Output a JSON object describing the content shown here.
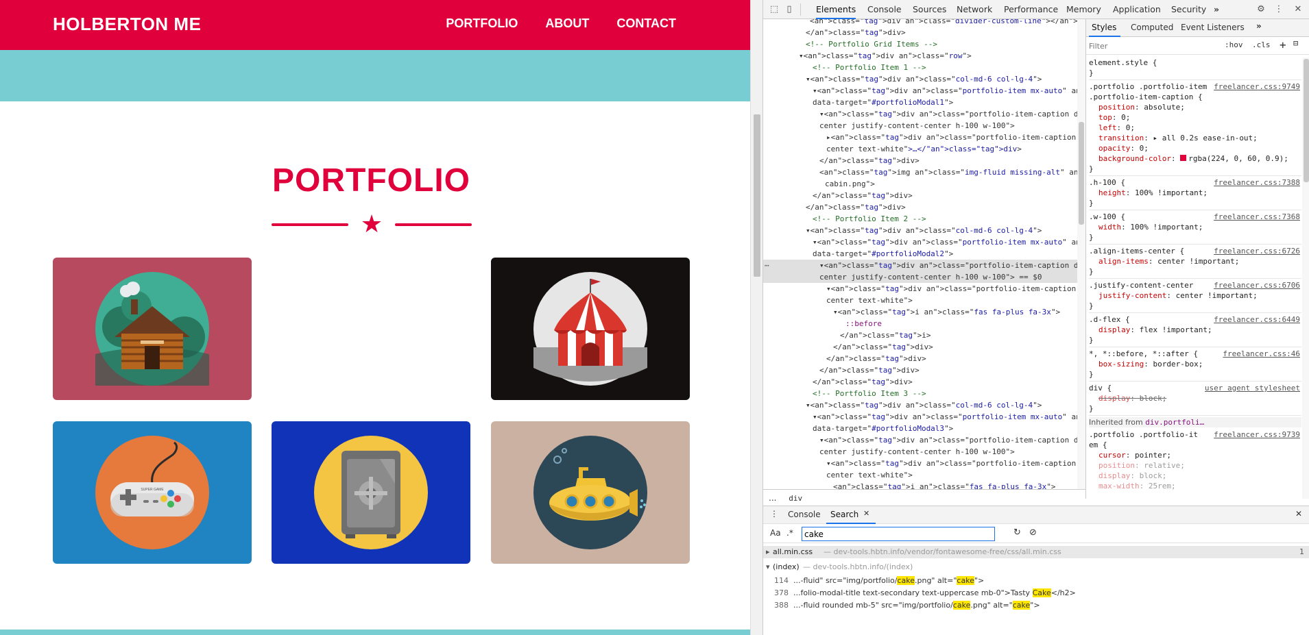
{
  "site": {
    "brand": "HOLBERTON ME",
    "nav": [
      "PORTFOLIO",
      "ABOUT",
      "CONTACT"
    ],
    "section_title": "PORTFOLIO",
    "colors": {
      "primary": "#e0003c",
      "band": "#78cdd2"
    },
    "tiles": [
      {
        "name": "cabin",
        "bg": "#b74a5f",
        "icon": "cabin-icon"
      },
      {
        "name": "circus",
        "bg": "#141010",
        "icon": "circus-tent-icon"
      },
      {
        "name": "game",
        "bg": "#1f84c1",
        "icon": "game-controller-icon"
      },
      {
        "name": "safe",
        "bg": "#1133b8",
        "icon": "safe-icon"
      },
      {
        "name": "submarine",
        "bg": "#cbb1a2",
        "icon": "submarine-icon"
      }
    ]
  },
  "devtools": {
    "tabs": [
      "Elements",
      "Console",
      "Sources",
      "Network",
      "Performance",
      "Memory",
      "Application",
      "Security"
    ],
    "active_tab": "Elements",
    "elements_lines": [
      {
        "t": "<div class=\"divider-custom-line\"></div>"
      },
      {
        "t": "</div>"
      },
      {
        "t": "<!-- Portfolio Grid Items -->"
      },
      {
        "t": "▾<div class=\"row\">"
      },
      {
        "t": "<!-- Portfolio Item 1 -->"
      },
      {
        "t": "▾<div class=\"col-md-6 col-lg-4\">"
      },
      {
        "t": "▾<div class=\"portfolio-item mx-auto\" data-toggle=\"modal\""
      },
      {
        "t": "data-target=\"#portfolioModal1\">"
      },
      {
        "t": "▾<div class=\"portfolio-item-caption d-flex align-items-"
      },
      {
        "t": "center justify-content-center h-100 w-100\">"
      },
      {
        "t": "▸<div class=\"portfolio-item-caption-content text-"
      },
      {
        "t": "center text-white\">…</div>"
      },
      {
        "t": "</div>"
      },
      {
        "t": "<img class=\"img-fluid missing-alt\" src=\"img/portfolio/"
      },
      {
        "t": "cabin.png\">"
      },
      {
        "t": "</div>"
      },
      {
        "t": "</div>"
      },
      {
        "t": "<!-- Portfolio Item 2 -->"
      },
      {
        "t": "▾<div class=\"col-md-6 col-lg-4\">"
      },
      {
        "t": "▾<div class=\"portfolio-item mx-auto\" data-toggle=\"modal\""
      },
      {
        "t": "data-target=\"#portfolioModal2\">"
      },
      {
        "t": "▾<div class=\"portfolio-item-caption d-flex align-items-"
      },
      {
        "t": "center justify-content-center h-100 w-100\"> == $0"
      },
      {
        "t": "▾<div class=\"portfolio-item-caption-content text-"
      },
      {
        "t": "center text-white\">"
      },
      {
        "t": "▾<i class=\"fas fa-plus fa-3x\">"
      },
      {
        "t": "::before"
      },
      {
        "t": "</i>"
      },
      {
        "t": "</div>"
      },
      {
        "t": "</div>"
      },
      {
        "t": "</div>"
      },
      {
        "t": "</div>"
      },
      {
        "t": "<!-- Portfolio Item 3 -->"
      },
      {
        "t": "▾<div class=\"col-md-6 col-lg-4\">"
      },
      {
        "t": "▾<div class=\"portfolio-item mx-auto\" data-toggle=\"modal\""
      },
      {
        "t": "data-target=\"#portfolioModal3\">"
      },
      {
        "t": "▾<div class=\"portfolio-item-caption d-flex align-items-"
      },
      {
        "t": "center justify-content-center h-100 w-100\">"
      },
      {
        "t": "▾<div class=\"portfolio-item-caption-content text-"
      },
      {
        "t": "center text-white\">"
      },
      {
        "t": "<i class=\"fas fa-plus fa-3x\">"
      }
    ],
    "breadcrumb": [
      "...",
      "div"
    ],
    "styles_tabs": [
      "Styles",
      "Computed",
      "Event Listeners"
    ],
    "filter_placeholder": "Filter",
    "hov_label": ":hov",
    "cls_label": ".cls",
    "style_rules": [
      {
        "selector": "element.style {",
        "props": [],
        "src": ""
      },
      {
        "selector": ".portfolio .portfolio-item .portfolio-item-caption {",
        "src": "freelancer.css:9749",
        "props": [
          {
            "p": "position",
            "v": "absolute;"
          },
          {
            "p": "top",
            "v": "0;"
          },
          {
            "p": "left",
            "v": "0;"
          },
          {
            "p": "transition",
            "v": "▸ all 0.2s ease-in-out;"
          },
          {
            "p": "opacity",
            "v": "0;"
          },
          {
            "p": "background-color",
            "v": "rgba(224, 0, 60, 0.9);"
          }
        ]
      },
      {
        "selector": ".h-100 {",
        "src": "freelancer.css:7388",
        "props": [
          {
            "p": "height",
            "v": "100% !important;"
          }
        ]
      },
      {
        "selector": ".w-100 {",
        "src": "freelancer.css:7368",
        "props": [
          {
            "p": "width",
            "v": "100% !important;"
          }
        ]
      },
      {
        "selector": ".align-items-center {",
        "src": "freelancer.css:6726",
        "props": [
          {
            "p": "align-items",
            "v": "center !important;"
          }
        ]
      },
      {
        "selector": ".justify-content-center",
        "src": "freelancer.css:6706",
        "props": [
          {
            "p": "justify-content",
            "v": "center !important;"
          }
        ]
      },
      {
        "selector": ".d-flex {",
        "src": "freelancer.css:6449",
        "props": [
          {
            "p": "display",
            "v": "flex !important;"
          }
        ]
      },
      {
        "selector": "*, *::before, *::after {",
        "src": "freelancer.css:46",
        "props": [
          {
            "p": "box-sizing",
            "v": "border-box;"
          }
        ]
      },
      {
        "selector": "div {",
        "src": "user agent stylesheet",
        "props": [
          {
            "p": "display",
            "v": "block;"
          }
        ]
      }
    ],
    "inherited_label": "Inherited from",
    "inherited_from": "div.portfoli…",
    "inherited_rule": {
      "selector": ".portfolio .portfolio-item {",
      "src": "freelancer.css:9739",
      "props": [
        {
          "p": "cursor",
          "v": "pointer;"
        },
        {
          "p": "position",
          "v": "relative;"
        },
        {
          "p": "display",
          "v": "block;"
        },
        {
          "p": "max-width",
          "v": "25rem;"
        }
      ]
    },
    "drawer_tabs": [
      "Console",
      "Search"
    ],
    "search_value": "cake",
    "search_results": [
      {
        "file": "all.min.css",
        "path": "— dev-tools.hbtn.info/vendor/fontawesome-free/css/all.min.css",
        "count": "1"
      },
      {
        "file": "(index)",
        "path": "— dev-tools.hbtn.info/(index)"
      }
    ],
    "search_hits": [
      {
        "line": "114",
        "pre": "...-fluid\" src=\"img/portfolio/",
        "m1": "cake",
        "mid": ".png\" alt=\"",
        "m2": "cake",
        "post": "\">"
      },
      {
        "line": "378",
        "pre": "...folio-modal-title text-secondary text-uppercase mb-0\">Tasty ",
        "m1": "Cake",
        "mid": "</h2>",
        "m2": "",
        "post": ""
      },
      {
        "line": "388",
        "pre": "...-fluid rounded mb-5\" src=\"img/portfolio/",
        "m1": "cake",
        "mid": ".png\" alt=\"",
        "m2": "cake",
        "post": "\">"
      }
    ]
  }
}
